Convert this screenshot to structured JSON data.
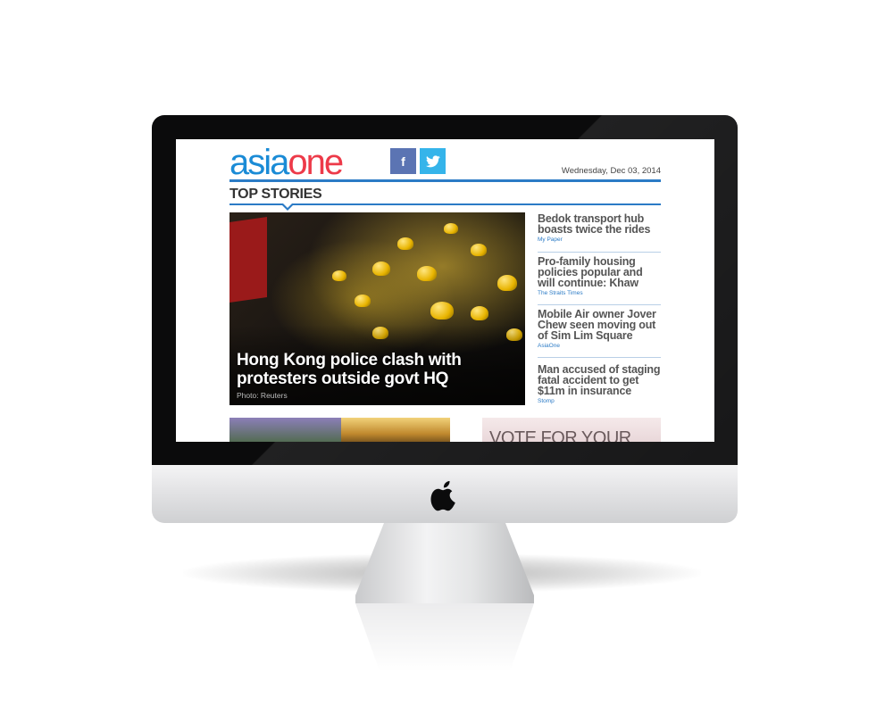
{
  "site": {
    "logo_part1": "asia",
    "logo_part2": "one",
    "facebook_icon": "facebook-icon",
    "twitter_icon": "twitter-icon",
    "date": "Wednesday, Dec 03, 2014",
    "colors": {
      "brand_blue": "#1a8bd6",
      "brand_red": "#ed3a49",
      "rule_blue": "#2b7bc6"
    }
  },
  "top_stories": {
    "title": "TOP STORIES",
    "main": {
      "headline": "Hong Kong police clash with protesters outside govt HQ",
      "credit": "Photo: Reuters"
    },
    "side": [
      {
        "headline": "Bedok transport hub boasts twice the rides",
        "source": "My Paper"
      },
      {
        "headline": "Pro-family housing policies popular and will continue: Khaw",
        "source": "The Straits Times"
      },
      {
        "headline": "Mobile Air owner Jover Chew seen moving out of Sim Lim Square",
        "source": "AsiaOne"
      },
      {
        "headline": "Man accused of staging fatal accident to get $11m in insurance",
        "source": "Stomp"
      }
    ]
  },
  "ad": {
    "text": "VOTE FOR YOUR"
  }
}
